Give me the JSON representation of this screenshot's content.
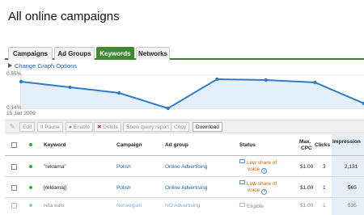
{
  "page": {
    "title": "All online campaigns"
  },
  "tabs": [
    {
      "label": "Campaigns",
      "active": false
    },
    {
      "label": "Ad Groups",
      "active": false
    },
    {
      "label": "Keywords",
      "active": true
    },
    {
      "label": "Networks",
      "active": false
    }
  ],
  "graph": {
    "options_label": "Change Graph Options"
  },
  "chart_data": {
    "type": "line",
    "y_top_label": "0.55%",
    "y_bottom_label": "0.14%",
    "x_start_label": "15 Jan 2009",
    "series": [
      {
        "values": [
          0.47,
          0.4,
          0.33,
          0.14,
          0.5,
          0.49,
          0.46,
          0.2
        ]
      }
    ],
    "ylim": [
      0.14,
      0.55
    ],
    "color": "#2f7cc7",
    "fill": "#e3effa"
  },
  "toolbar": {
    "edit": "Edit",
    "pause": "Pause",
    "enable": "Enable",
    "delete": "Delete",
    "show_query": "Show query report",
    "copy": "Copy",
    "download": "Download"
  },
  "table": {
    "headers": {
      "keyword": "Keyword",
      "campaign": "Campaign",
      "ad_group": "Ad group",
      "status": "Status",
      "max_cpc_1": "Max.",
      "max_cpc_2": "CPC",
      "clicks": "Clicks",
      "impressions": "Impression"
    },
    "rows": [
      {
        "keyword": "\"reklama\"",
        "campaign": "Polish",
        "ad_group": "Online Advertising",
        "status_1": "Low share of",
        "status_2": "voice",
        "max_cpc": "$1.00",
        "clicks": "3",
        "impressions": "2,131"
      },
      {
        "keyword": "[reklamaj]",
        "campaign": "Polish",
        "ad_group": "Online Advertising",
        "status_1": "Low share of",
        "status_2": "voice",
        "max_cpc": "$1.00",
        "clicks": "1",
        "impressions": "565"
      },
      {
        "keyword": "reta eats",
        "campaign": "Norwegian",
        "ad_group": "NO Advertising",
        "status_1": "Eligible",
        "status_2": "",
        "max_cpc": "$1.00",
        "clicks": "1",
        "impressions": "535"
      }
    ]
  },
  "colors": {
    "accent_green": "#3f8a2f",
    "link_blue": "#1d5ea8",
    "warning_orange": "#d25c00"
  }
}
